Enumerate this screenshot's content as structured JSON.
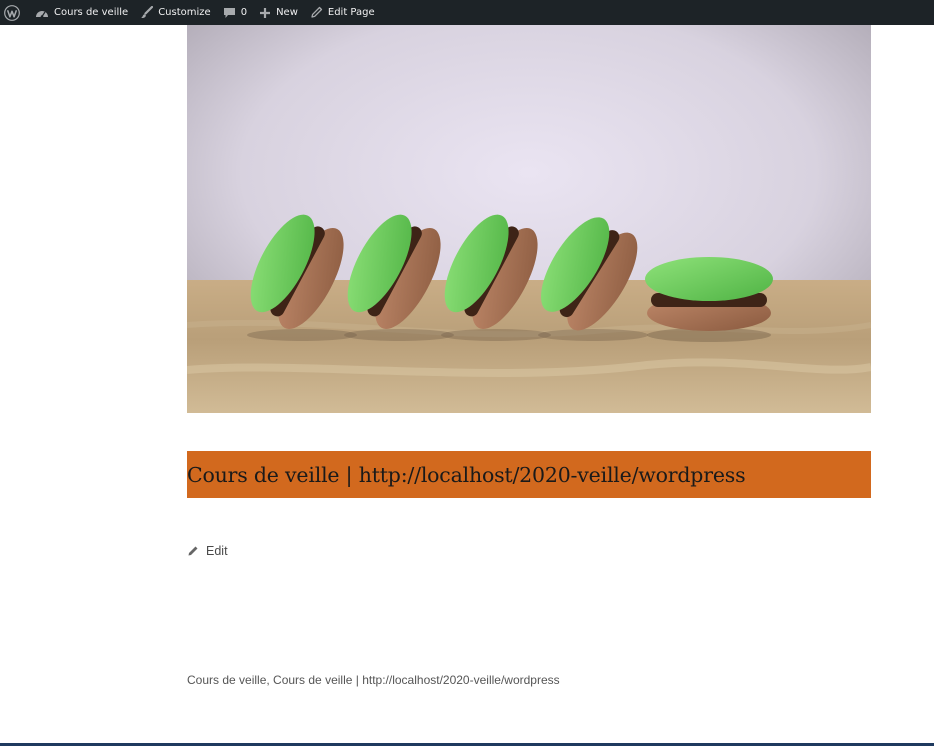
{
  "admin_bar": {
    "wp_logo_icon": "wordpress-logo-icon",
    "site_name": "Cours de veille",
    "customize": "Customize",
    "comments_count": "0",
    "new": "New",
    "edit_page": "Edit Page"
  },
  "hero": {
    "image": "green-macarons-photo",
    "alt": "Five green macarons leaning in a row on a stone surface"
  },
  "title_bar": {
    "title": "Cours de veille | http://localhost/2020-veille/wordpress",
    "background": "#d2691e"
  },
  "edit": {
    "label": "Edit",
    "icon": "pencil-icon"
  },
  "footer": {
    "text": "Cours de veille, Cours de veille | http://localhost/2020-veille/wordpress"
  }
}
